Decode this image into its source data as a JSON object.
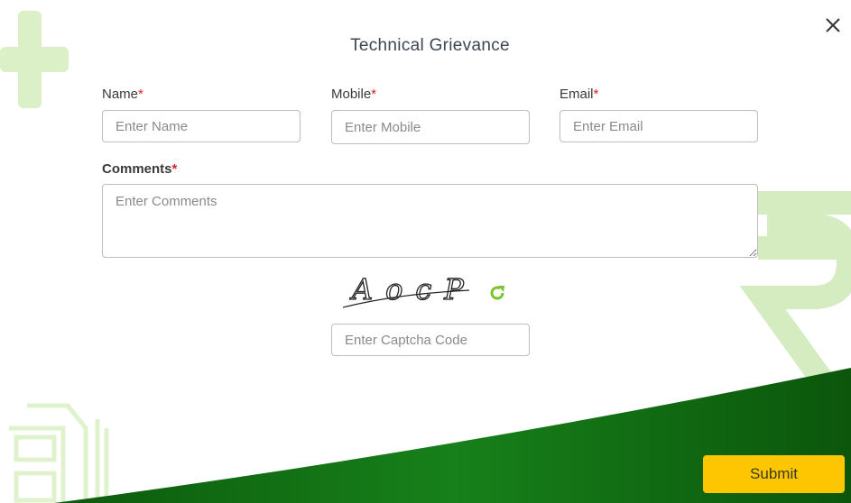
{
  "dialog": {
    "title": "Technical Grievance",
    "close_icon": "close-icon"
  },
  "fields": {
    "name": {
      "label": "Name",
      "required_mark": "*",
      "placeholder": "Enter Name",
      "value": ""
    },
    "mobile": {
      "label": "Mobile",
      "required_mark": "*",
      "placeholder": "Enter Mobile",
      "value": ""
    },
    "email": {
      "label": "Email",
      "required_mark": "*",
      "placeholder": "Enter Email",
      "value": ""
    },
    "comments": {
      "label": "Comments",
      "required_mark": "*",
      "placeholder": "Enter Comments",
      "value": ""
    }
  },
  "captcha": {
    "text": "AocP",
    "refresh_icon": "refresh-icon",
    "placeholder": "Enter Captcha Code",
    "value": ""
  },
  "submit_label": "Submit",
  "colors": {
    "accent_green": "#1a7a12",
    "submit_yellow": "#fdc600",
    "required_red": "#e02020",
    "refresh_green": "#7cc42a"
  }
}
